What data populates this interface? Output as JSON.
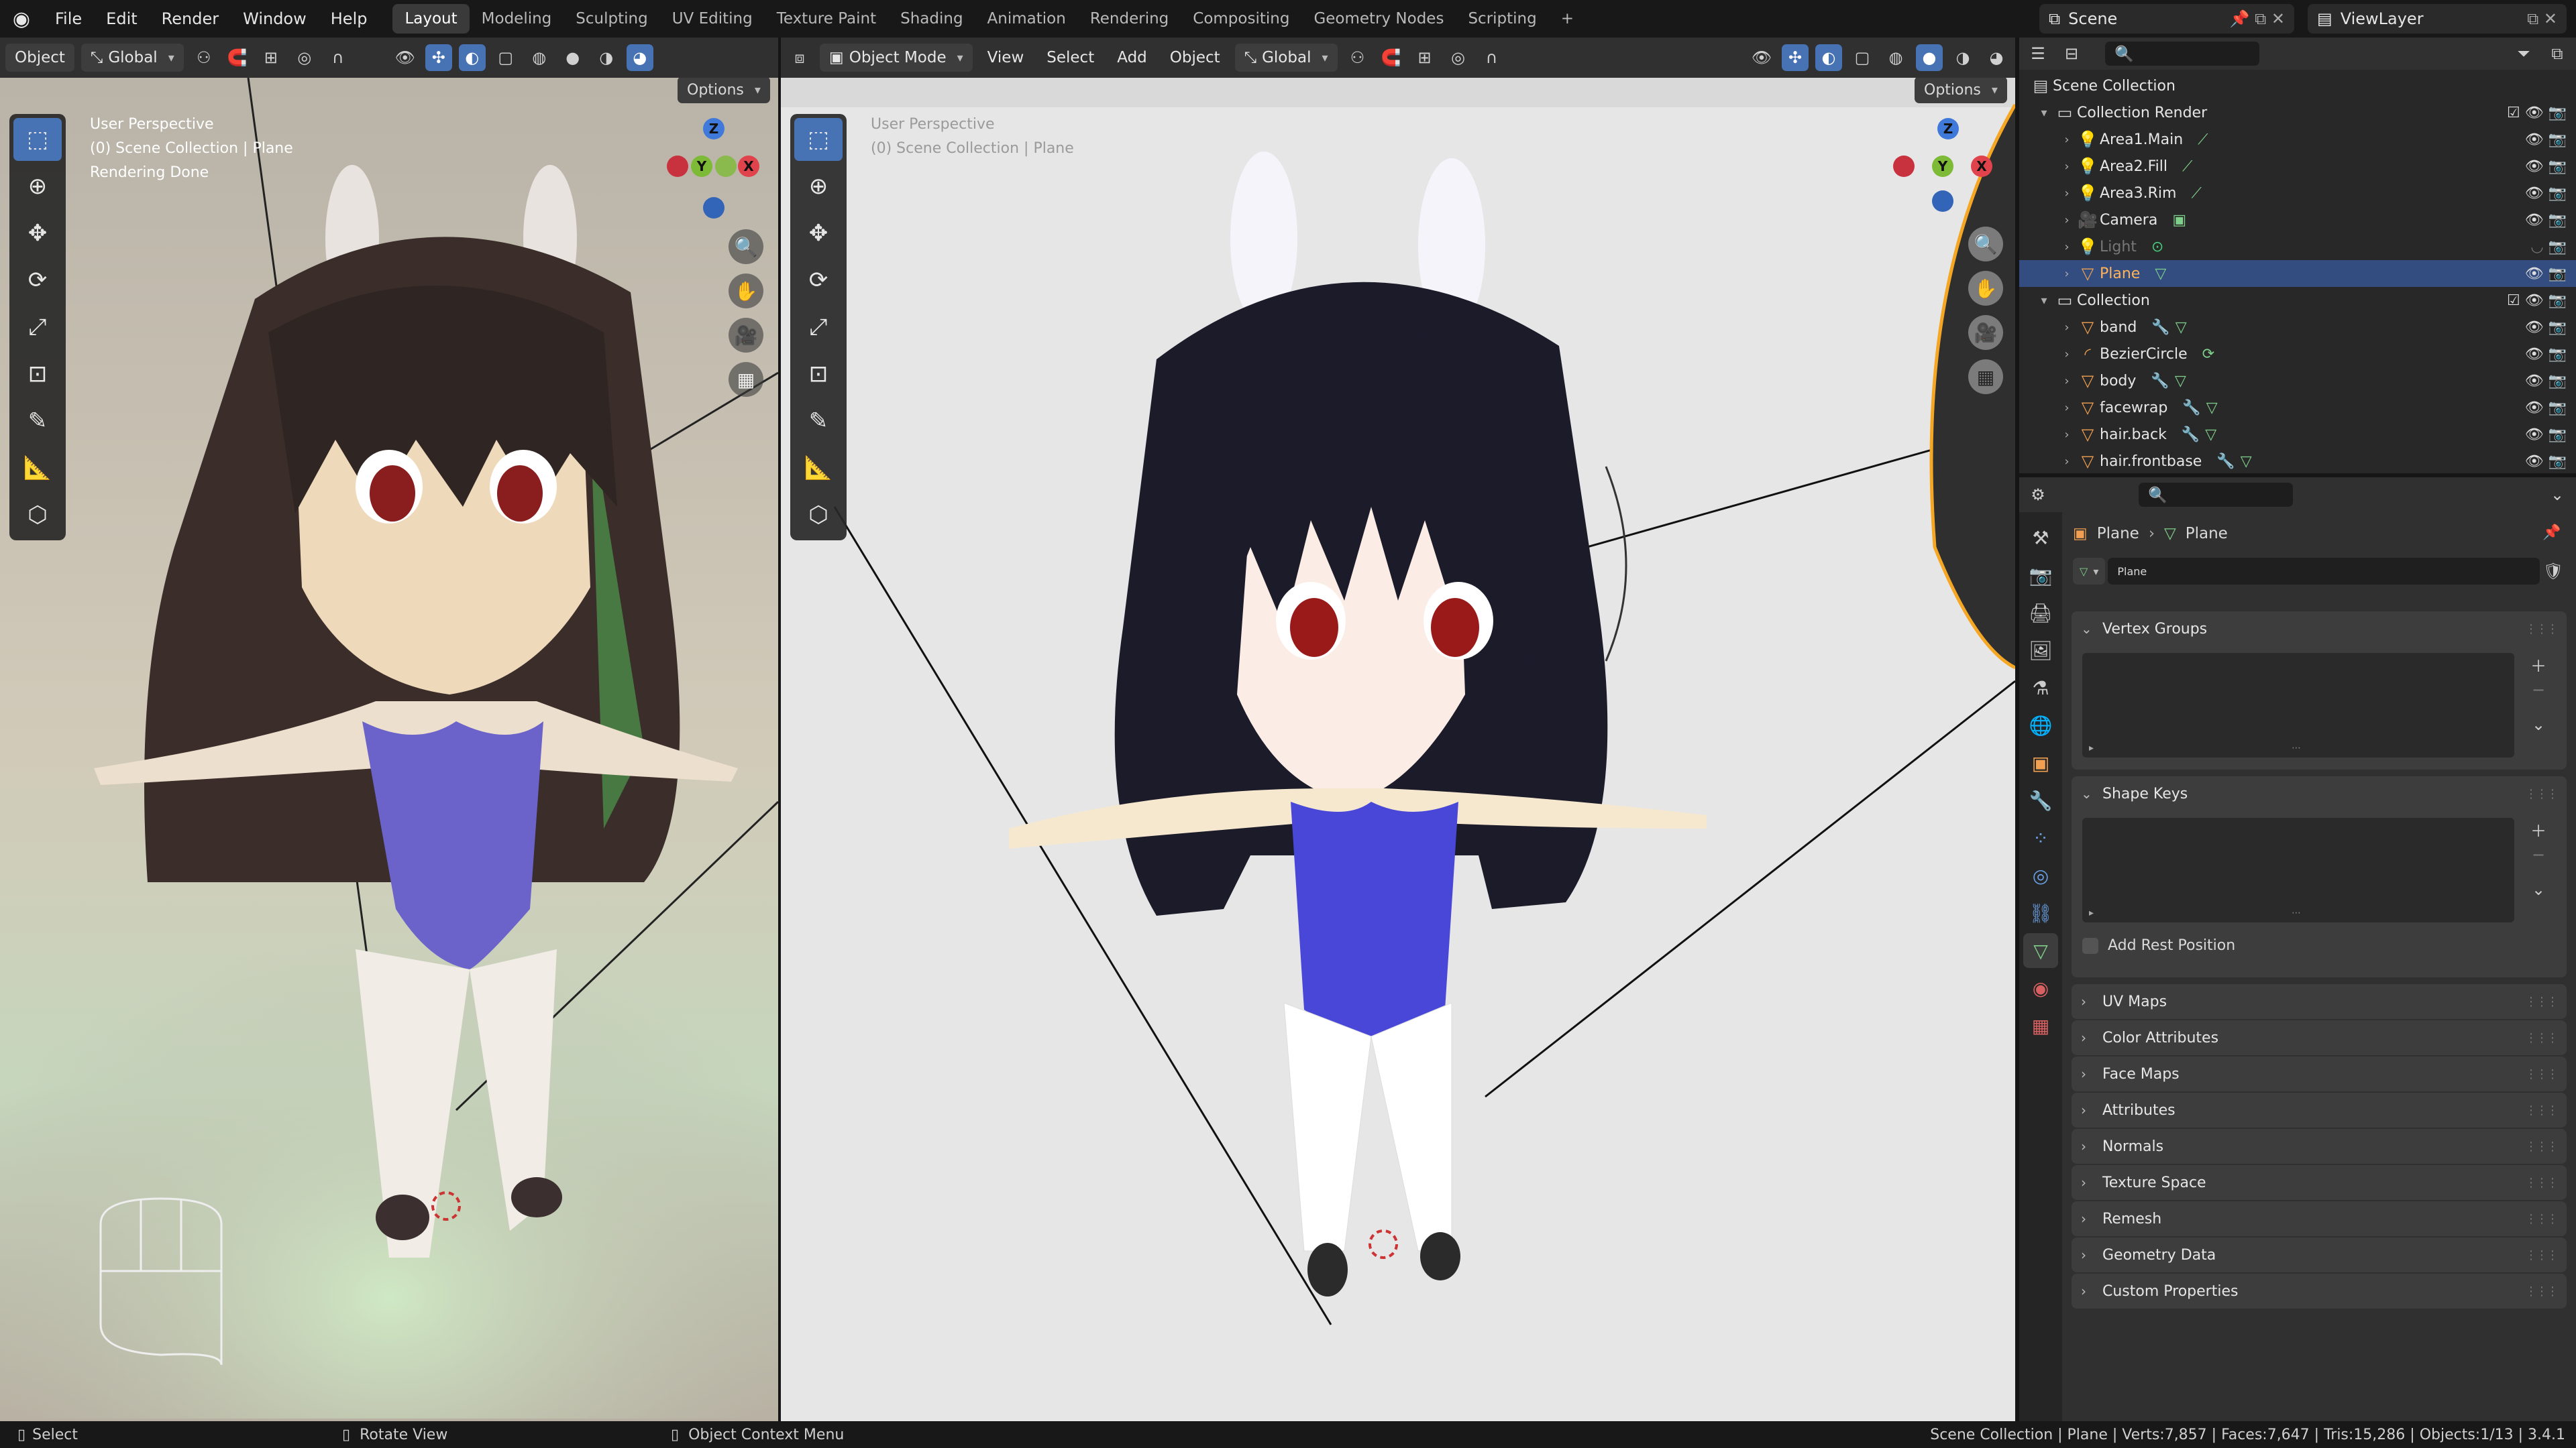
{
  "topbar": {
    "menus": [
      "File",
      "Edit",
      "Render",
      "Window",
      "Help"
    ],
    "workspaces": [
      "Layout",
      "Modeling",
      "Sculpting",
      "UV Editing",
      "Texture Paint",
      "Shading",
      "Animation",
      "Rendering",
      "Compositing",
      "Geometry Nodes",
      "Scripting"
    ],
    "active_workspace": "Layout",
    "add_tab": "+",
    "scene": "Scene",
    "view_layer": "ViewLayer"
  },
  "left_view": {
    "mode_label": "Object",
    "orientation": "Global",
    "options": "Options",
    "overlay": [
      "User Perspective",
      "(0) Scene Collection | Plane",
      "Rendering Done"
    ]
  },
  "right_view": {
    "mode": "Object Mode",
    "menus": [
      "View",
      "Select",
      "Add",
      "Object"
    ],
    "orientation": "Global",
    "options": "Options",
    "overlay": [
      "User Perspective",
      "(0) Scene Collection | Plane"
    ]
  },
  "gizmo": {
    "x": "X",
    "y": "Y",
    "z": "Z",
    "x_color": "#e0434b",
    "y_color": "#7dba36",
    "z_color": "#3f79d9"
  },
  "outliner": {
    "root": "Scene Collection",
    "items": [
      {
        "name": "Collection Render",
        "type": "collection",
        "indent": 1,
        "expanded": true
      },
      {
        "name": "Area1.Main",
        "type": "light",
        "indent": 2
      },
      {
        "name": "Area2.Fill",
        "type": "light",
        "indent": 2
      },
      {
        "name": "Area3.Rim",
        "type": "light",
        "indent": 2
      },
      {
        "name": "Camera",
        "type": "camera",
        "indent": 2
      },
      {
        "name": "Light",
        "type": "light",
        "indent": 2,
        "hidden": true
      },
      {
        "name": "Plane",
        "type": "mesh",
        "indent": 2,
        "selected": true
      },
      {
        "name": "Collection",
        "type": "collection",
        "indent": 1,
        "expanded": true
      },
      {
        "name": "band",
        "type": "mesh",
        "indent": 2
      },
      {
        "name": "BezierCircle",
        "type": "curve",
        "indent": 2
      },
      {
        "name": "body",
        "type": "mesh",
        "indent": 2
      },
      {
        "name": "facewrap",
        "type": "mesh",
        "indent": 2
      },
      {
        "name": "hair.back",
        "type": "mesh",
        "indent": 2
      },
      {
        "name": "hair.frontbase",
        "type": "mesh",
        "indent": 2
      }
    ]
  },
  "properties": {
    "breadcrumb": [
      "Plane",
      "Plane"
    ],
    "data_name": "Plane",
    "vertex_groups": "Vertex Groups",
    "shape_keys": "Shape Keys",
    "add_rest_position": "Add Rest Position",
    "collapsed_panels": [
      "UV Maps",
      "Color Attributes",
      "Face Maps",
      "Attributes",
      "Normals",
      "Texture Space",
      "Remesh",
      "Geometry Data",
      "Custom Properties"
    ]
  },
  "status": {
    "left": [
      {
        "icon": "mouse-left-icon",
        "label": "Select"
      },
      {
        "icon": "mouse-middle-icon",
        "label": "Rotate View"
      },
      {
        "icon": "mouse-right-icon",
        "label": "Object Context Menu"
      }
    ],
    "right": "Scene Collection | Plane | Verts:7,857 | Faces:7,647 | Tris:15,286 | Objects:1/13 | 3.4.1"
  },
  "colors": {
    "accent": "#4772b3",
    "selection": "#334d80",
    "active_object": "#f5a623"
  }
}
